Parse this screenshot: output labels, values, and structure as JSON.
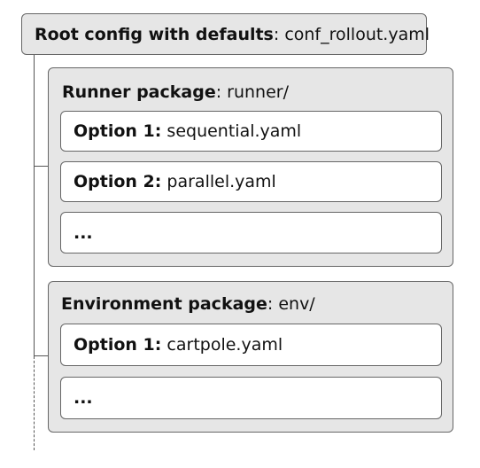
{
  "root": {
    "label_bold": "Root config with defaults",
    "label_rest": ": conf_rollout.yaml"
  },
  "packages": [
    {
      "title_bold": "Runner package",
      "title_rest": ": runner/",
      "options": [
        {
          "bold": "Option 1:",
          "rest": " sequential.yaml"
        },
        {
          "bold": "Option 2:",
          "rest": " parallel.yaml"
        },
        {
          "bold": "...",
          "rest": ""
        }
      ]
    },
    {
      "title_bold": "Environment package",
      "title_rest": ": env/",
      "options": [
        {
          "bold": "Option 1:",
          "rest": " cartpole.yaml"
        },
        {
          "bold": "...",
          "rest": ""
        }
      ]
    }
  ]
}
